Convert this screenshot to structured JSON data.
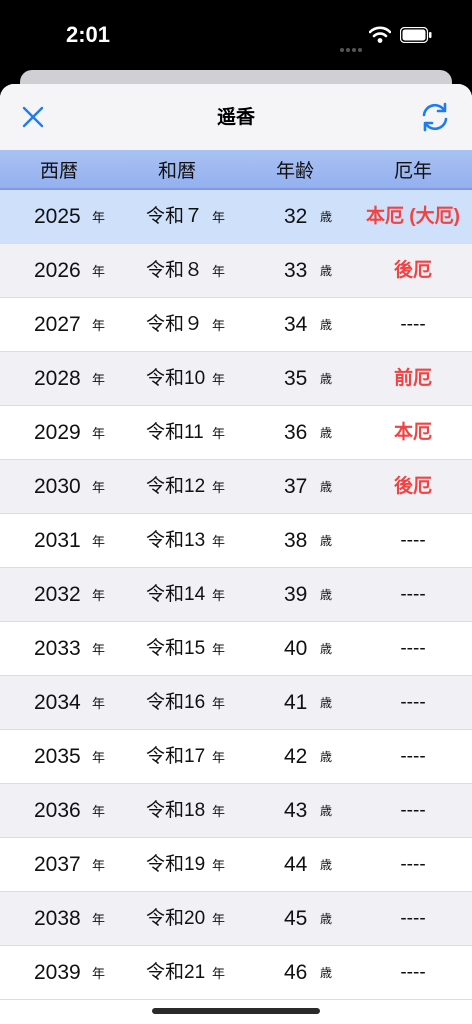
{
  "status_bar": {
    "time": "2:01"
  },
  "nav": {
    "title": "遥香",
    "close_icon": "close-icon",
    "refresh_icon": "refresh-icon"
  },
  "colors": {
    "accent": "#1e7cf2",
    "header_bg": "#a9c2f3",
    "current_row": "#cfe0fa",
    "yaku_red": "#f04343"
  },
  "table": {
    "headers": [
      "西暦",
      "和暦",
      "年齢",
      "厄年"
    ],
    "year_unit": "年",
    "age_unit": "歳",
    "rows": [
      {
        "year": "2025",
        "era": "令和７",
        "age": "32",
        "yaku": "本厄 (大厄)"
      },
      {
        "year": "2026",
        "era": "令和８",
        "age": "33",
        "yaku": "後厄"
      },
      {
        "year": "2027",
        "era": "令和９",
        "age": "34",
        "yaku": "----"
      },
      {
        "year": "2028",
        "era": "令和10",
        "age": "35",
        "yaku": "前厄"
      },
      {
        "year": "2029",
        "era": "令和11",
        "age": "36",
        "yaku": "本厄"
      },
      {
        "year": "2030",
        "era": "令和12",
        "age": "37",
        "yaku": "後厄"
      },
      {
        "year": "2031",
        "era": "令和13",
        "age": "38",
        "yaku": "----"
      },
      {
        "year": "2032",
        "era": "令和14",
        "age": "39",
        "yaku": "----"
      },
      {
        "year": "2033",
        "era": "令和15",
        "age": "40",
        "yaku": "----"
      },
      {
        "year": "2034",
        "era": "令和16",
        "age": "41",
        "yaku": "----"
      },
      {
        "year": "2035",
        "era": "令和17",
        "age": "42",
        "yaku": "----"
      },
      {
        "year": "2036",
        "era": "令和18",
        "age": "43",
        "yaku": "----"
      },
      {
        "year": "2037",
        "era": "令和19",
        "age": "44",
        "yaku": "----"
      },
      {
        "year": "2038",
        "era": "令和20",
        "age": "45",
        "yaku": "----"
      },
      {
        "year": "2039",
        "era": "令和21",
        "age": "46",
        "yaku": "----"
      }
    ]
  }
}
